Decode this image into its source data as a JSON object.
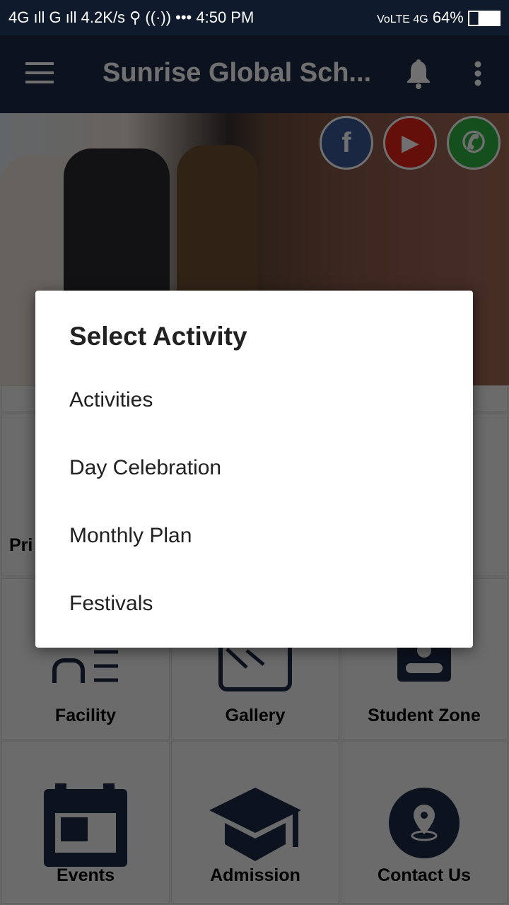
{
  "status_bar": {
    "left": "4G ıll G ıll 4.2K/s ⚲ ((·)) ••• ",
    "time": "4:50 PM",
    "network": "VoLTE 4G",
    "battery": "64%"
  },
  "app_bar": {
    "title": "Sunrise Global Sch...",
    "icons": [
      "menu-icon",
      "bell-icon",
      "more-vert-icon"
    ]
  },
  "banner": {
    "social": [
      {
        "name": "facebook",
        "glyph": "f",
        "color": "#3b5998"
      },
      {
        "name": "youtube",
        "glyph": "▶",
        "color": "#e62117"
      },
      {
        "name": "whatsapp",
        "glyph": "✆",
        "color": "#2fb344"
      }
    ]
  },
  "grid": {
    "icon_color": "#1b2a44",
    "items": [
      {
        "label": "Pri"
      },
      {
        "label": "Facility"
      },
      {
        "label": "Gallery"
      },
      {
        "label": "Student Zone"
      },
      {
        "label": "Events"
      },
      {
        "label": "Admission"
      },
      {
        "label": "Contact Us"
      }
    ]
  },
  "dialog": {
    "title": "Select Activity",
    "options": [
      "Activities",
      "Day Celebration",
      "Monthly Plan",
      "Festivals"
    ]
  }
}
